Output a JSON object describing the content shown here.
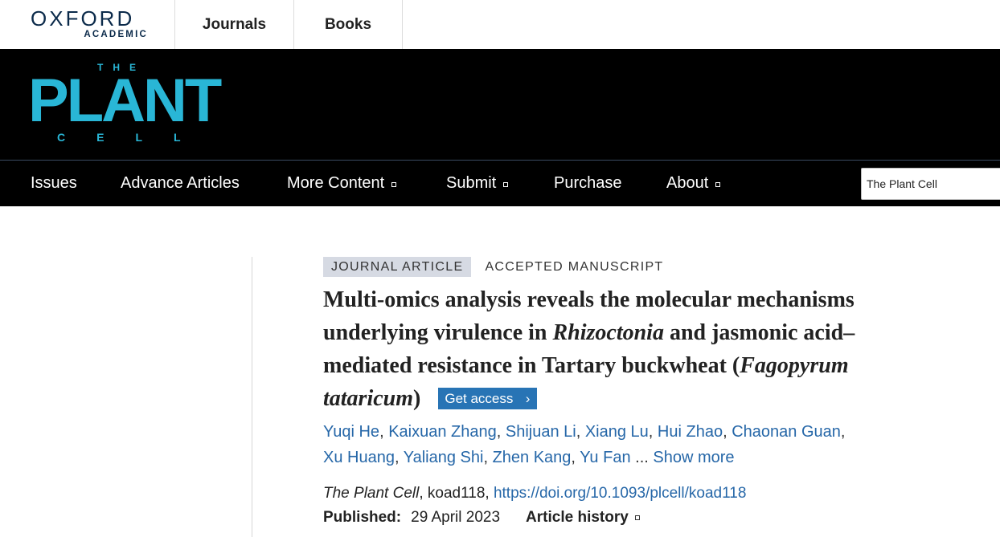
{
  "site": {
    "brand_top": "OXFORD",
    "brand_bottom": "ACADEMIC",
    "tabs": [
      "Journals",
      "Books"
    ]
  },
  "journal": {
    "logo_the": "THE",
    "logo_plant": "PLANT",
    "logo_cell": "CELL"
  },
  "nav": {
    "items": [
      {
        "label": "Issues",
        "has_menu": false
      },
      {
        "label": "Advance Articles",
        "has_menu": false
      },
      {
        "label": "More Content",
        "has_menu": true
      },
      {
        "label": "Submit",
        "has_menu": true
      },
      {
        "label": "Purchase",
        "has_menu": false
      },
      {
        "label": "About",
        "has_menu": true
      }
    ],
    "search_value": "The Plant Cell"
  },
  "article": {
    "type_label": "JOURNAL ARTICLE",
    "status_label": "ACCEPTED MANUSCRIPT",
    "title_part1": "Multi-omics analysis reveals the molecular mechanisms underlying virulence in ",
    "title_italic1": "Rhizoctonia",
    "title_part2": " and jasmonic acid–mediated resistance in Tartary buckwheat (",
    "title_italic2": "Fagopyrum tataricum",
    "title_part3": ")",
    "get_access_label": "Get access",
    "authors": [
      "Yuqi He",
      "Kaixuan Zhang",
      "Shijuan Li",
      "Xiang Lu",
      "Hui Zhao",
      "Chaonan Guan",
      "Xu Huang",
      "Yaliang Shi",
      "Zhen Kang",
      "Yu Fan"
    ],
    "authors_ellipsis": "...",
    "show_more_label": "Show more",
    "journal_name": "The Plant Cell",
    "article_id": ", koad118, ",
    "doi": "https://doi.org/10.1093/plcell/koad118",
    "published_label": "Published:",
    "published_date": "29 April 2023",
    "history_label": "Article history"
  },
  "colors": {
    "brand_navy": "#0b2a4a",
    "journal_cyan": "#29b6d6",
    "link_blue": "#2667a8",
    "button_blue": "#2874b5",
    "label_bg": "#d6dae3"
  }
}
